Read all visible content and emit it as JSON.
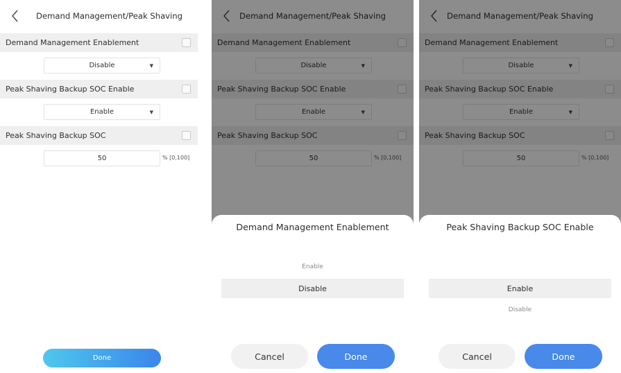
{
  "screen1": {
    "title": "Demand Management/Peak Shaving",
    "rows": [
      {
        "label": "Demand Management Enablement",
        "value": "Disable"
      },
      {
        "label": "Peak Shaving Backup SOC Enable",
        "value": "Enable"
      },
      {
        "label": "Peak Shaving Backup SOC",
        "value": "50",
        "unit": "% [0,100]"
      }
    ],
    "done_label": "Done"
  },
  "screen2": {
    "title": "Demand Management/Peak Shaving",
    "rows": [
      {
        "label": "Demand Management Enablement",
        "value": "Disable"
      },
      {
        "label": "Peak Shaving Backup SOC Enable",
        "value": "Enable"
      },
      {
        "label": "Peak Shaving Backup SOC",
        "value": "50",
        "unit": "% [0,100]"
      }
    ],
    "sheet": {
      "title": "Demand Management Enablement",
      "options": [
        "Enable",
        "Disable"
      ],
      "selected": "Disable",
      "cancel_label": "Cancel",
      "done_label": "Done"
    }
  },
  "screen3": {
    "title": "Demand Management/Peak Shaving",
    "rows": [
      {
        "label": "Demand Management Enablement",
        "value": "Disable"
      },
      {
        "label": "Peak Shaving Backup SOC Enable",
        "value": "Enable"
      },
      {
        "label": "Peak Shaving Backup SOC",
        "value": "50",
        "unit": "% [0,100]"
      }
    ],
    "sheet": {
      "title": "Peak Shaving Backup SOC Enable",
      "options": [
        "Enable",
        "Disable"
      ],
      "selected": "Enable",
      "cancel_label": "Cancel",
      "done_label": "Done"
    }
  },
  "colors": {
    "primary": "#4889ea",
    "gradient_start": "#4fc7ee",
    "gradient_end": "#3a86ea",
    "row_bg": "#efefef"
  }
}
